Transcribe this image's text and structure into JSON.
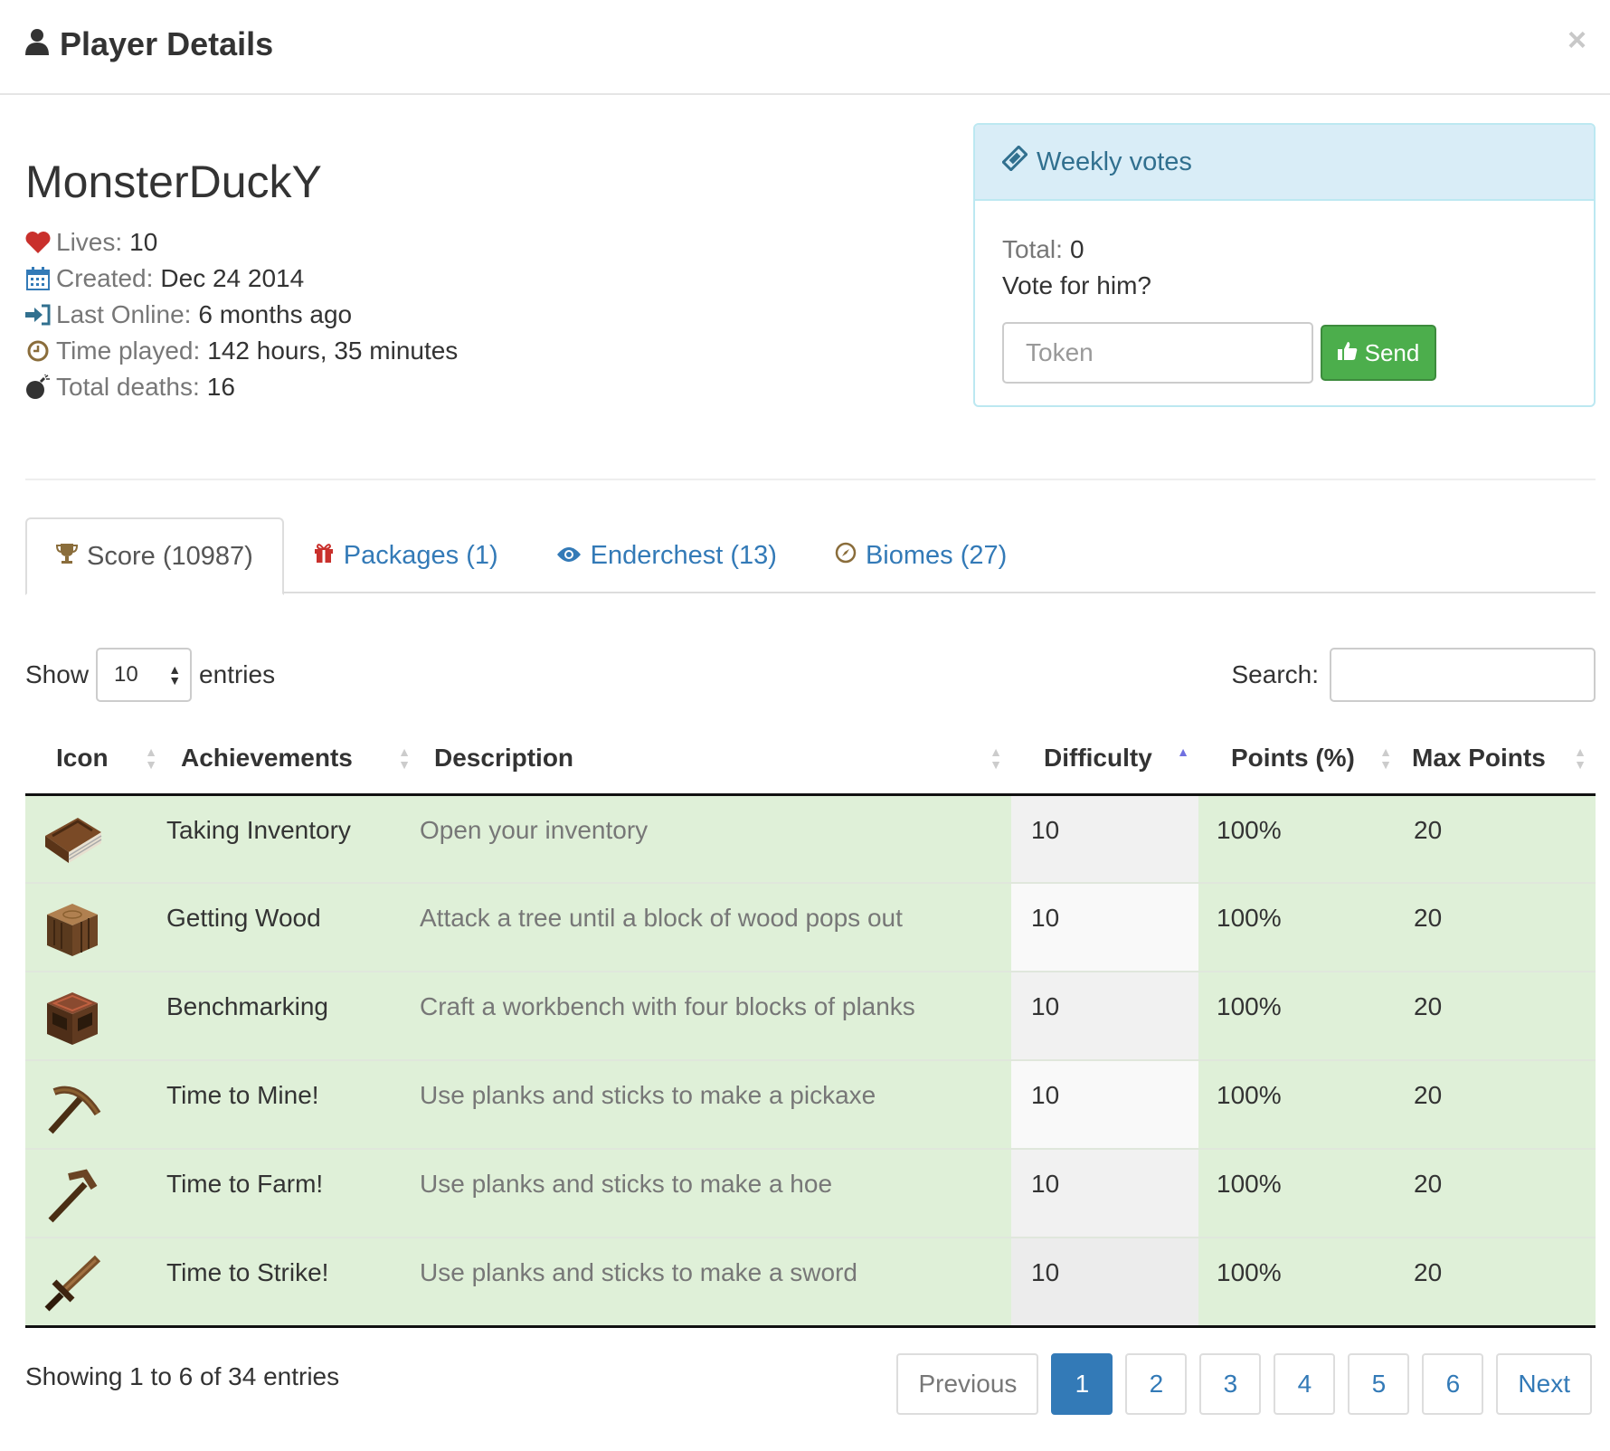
{
  "modal": {
    "title": "Player Details",
    "close_symbol": "×"
  },
  "player": {
    "name": "MonsterDuckY",
    "stats": [
      {
        "icon": "heart-icon",
        "label": "Lives:",
        "value": "10"
      },
      {
        "icon": "calendar-icon",
        "label": "Created:",
        "value": "Dec 24 2014"
      },
      {
        "icon": "sign-in-icon",
        "label": "Last Online:",
        "value": "6 months ago"
      },
      {
        "icon": "clock-icon",
        "label": "Time played:",
        "value": "142 hours, 35 minutes"
      },
      {
        "icon": "bomb-icon",
        "label": "Total deaths:",
        "value": "16"
      }
    ]
  },
  "votes": {
    "heading": "Weekly votes",
    "total_label": "Total:",
    "total_value": "0",
    "prompt": "Vote for him?",
    "token_placeholder": "Token",
    "send_label": "Send"
  },
  "tabs": [
    {
      "label": "Score (10987)",
      "icon": "trophy-icon",
      "active": true
    },
    {
      "label": "Packages (1)",
      "icon": "gift-icon",
      "active": false
    },
    {
      "label": "Enderchest (13)",
      "icon": "eye-icon",
      "active": false
    },
    {
      "label": "Biomes (27)",
      "icon": "compass-icon",
      "active": false
    }
  ],
  "table_controls": {
    "show_label": "Show",
    "entries_value": "10",
    "entries_label": "entries",
    "search_label": "Search:"
  },
  "table": {
    "columns": [
      "Icon",
      "Achievements",
      "Description",
      "Difficulty",
      "Points (%)",
      "Max Points"
    ],
    "rows": [
      {
        "icon": "book-icon",
        "achievement": "Taking Inventory",
        "description": "Open your inventory",
        "difficulty": "10",
        "points": "100%",
        "max_points": "20"
      },
      {
        "icon": "wood-log-icon",
        "achievement": "Getting Wood",
        "description": "Attack a tree until a block of wood pops out",
        "difficulty": "10",
        "points": "100%",
        "max_points": "20"
      },
      {
        "icon": "workbench-icon",
        "achievement": "Benchmarking",
        "description": "Craft a workbench with four blocks of planks",
        "difficulty": "10",
        "points": "100%",
        "max_points": "20"
      },
      {
        "icon": "pickaxe-icon",
        "achievement": "Time to Mine!",
        "description": "Use planks and sticks to make a pickaxe",
        "difficulty": "10",
        "points": "100%",
        "max_points": "20"
      },
      {
        "icon": "hoe-icon",
        "achievement": "Time to Farm!",
        "description": "Use planks and sticks to make a hoe",
        "difficulty": "10",
        "points": "100%",
        "max_points": "20"
      },
      {
        "icon": "sword-icon",
        "achievement": "Time to Strike!",
        "description": "Use planks and sticks to make a sword",
        "difficulty": "10",
        "points": "100%",
        "max_points": "20"
      }
    ]
  },
  "footer": {
    "info": "Showing 1 to 6 of 34 entries",
    "previous": "Previous",
    "pages": [
      "1",
      "2",
      "3",
      "4",
      "5",
      "6"
    ],
    "next": "Next"
  },
  "colors": {
    "link": "#337ab7",
    "success_row": "#dff0d8",
    "send_button": "#4cae4c",
    "panel_heading": "#d9edf7"
  }
}
